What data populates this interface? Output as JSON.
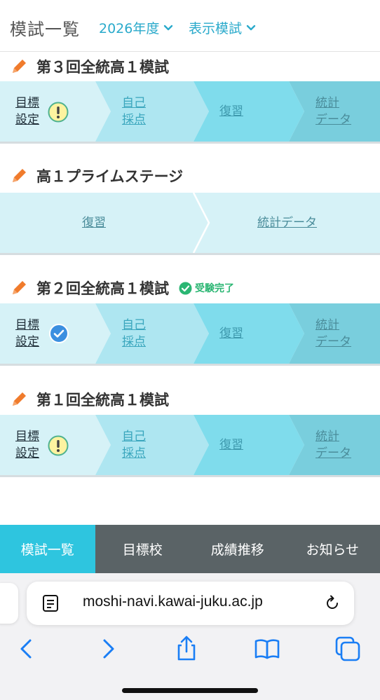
{
  "header": {
    "title": "模試一覧",
    "year_dropdown": "2026年度",
    "display_dropdown": "表示模試"
  },
  "exams": [
    {
      "title": "第３回全統高１模試",
      "steps": {
        "goal_line1": "目標",
        "goal_line2": "設定",
        "self_line1": "自己",
        "self_line2": "採点",
        "review": "復習",
        "stats_line1": "統計",
        "stats_line2": "データ"
      },
      "goal_status": "warning"
    },
    {
      "title": "高１プライムステージ",
      "steps": {
        "review": "復習",
        "stats": "統計データ"
      }
    },
    {
      "title": "第２回全統高１模試",
      "badge": "受験完了",
      "steps": {
        "goal_line1": "目標",
        "goal_line2": "設定",
        "self_line1": "自己",
        "self_line2": "採点",
        "review": "復習",
        "stats_line1": "統計",
        "stats_line2": "データ"
      },
      "goal_status": "done"
    },
    {
      "title": "第１回全統高１模試",
      "steps": {
        "goal_line1": "目標",
        "goal_line2": "設定",
        "self_line1": "自己",
        "self_line2": "採点",
        "review": "復習",
        "stats_line1": "統計",
        "stats_line2": "データ"
      },
      "goal_status": "warning"
    }
  ],
  "tabs": [
    "模試一覧",
    "目標校",
    "成績推移",
    "お知らせ"
  ],
  "browser": {
    "url": "moshi-navi.kawai-juku.ac.jp"
  },
  "colors": {
    "accent": "#2ec5df",
    "step1": "#d6f2f7",
    "step2": "#aee6f1",
    "step3": "#7fdcec",
    "step4": "#79cedd",
    "tabbar": "#5a6366",
    "link_blue": "#2aaacb",
    "warning_yellow": "#fdf3a0",
    "done_blue": "#3b8fe0",
    "badge_green": "#2bb673",
    "pencil_orange": "#f07b2c"
  }
}
